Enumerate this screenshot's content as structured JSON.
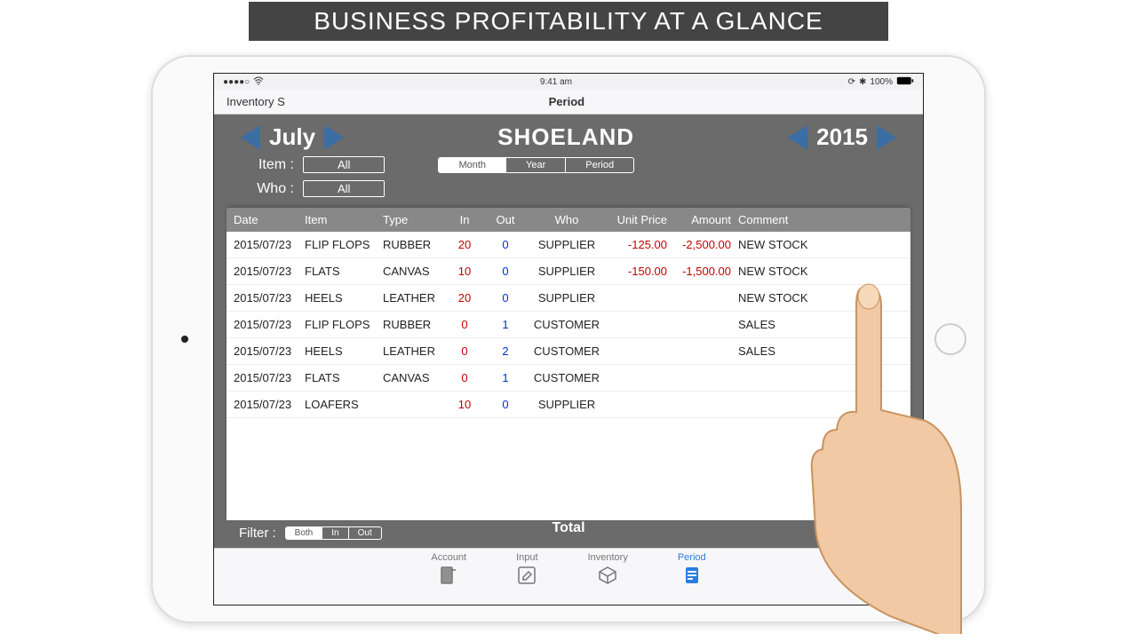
{
  "banner": "BUSINESS PROFITABILITY AT A GLANCE",
  "status": {
    "time": "9:41 am",
    "battery": "100%"
  },
  "nav": {
    "back": "Inventory S",
    "title": "Period"
  },
  "period": {
    "month": "July",
    "company": "SHOELAND",
    "year": "2015"
  },
  "filters": {
    "item_label": "Item :",
    "item_value": "All",
    "who_label": "Who :",
    "who_value": "All"
  },
  "view_tabs": [
    "Month",
    "Year",
    "Period"
  ],
  "view_active": 0,
  "columns": [
    "Date",
    "Item",
    "Type",
    "In",
    "Out",
    "Who",
    "Unit Price",
    "Amount",
    "Comment"
  ],
  "rows": [
    {
      "date": "2015/07/23",
      "item": "FLIP FLOPS",
      "type": "RUBBER",
      "in": "20",
      "out": "0",
      "who": "SUPPLIER",
      "price": "-125.00",
      "amount": "-2,500.00",
      "comment": "NEW STOCK"
    },
    {
      "date": "2015/07/23",
      "item": "FLATS",
      "type": "CANVAS",
      "in": "10",
      "out": "0",
      "who": "SUPPLIER",
      "price": "-150.00",
      "amount": "-1,500.00",
      "comment": "NEW STOCK"
    },
    {
      "date": "2015/07/23",
      "item": "HEELS",
      "type": "LEATHER",
      "in": "20",
      "out": "0",
      "who": "SUPPLIER",
      "price": "",
      "amount": "",
      "comment": "NEW STOCK"
    },
    {
      "date": "2015/07/23",
      "item": "FLIP FLOPS",
      "type": "RUBBER",
      "in": "0",
      "out": "1",
      "who": "CUSTOMER",
      "price": "",
      "amount": "",
      "comment": "SALES"
    },
    {
      "date": "2015/07/23",
      "item": "HEELS",
      "type": "LEATHER",
      "in": "0",
      "out": "2",
      "who": "CUSTOMER",
      "price": "",
      "amount": "",
      "comment": "SALES"
    },
    {
      "date": "2015/07/23",
      "item": "FLATS",
      "type": "CANVAS",
      "in": "0",
      "out": "1",
      "who": "CUSTOMER",
      "price": "",
      "amount": "",
      "comment": ""
    },
    {
      "date": "2015/07/23",
      "item": "LOAFERS",
      "type": "",
      "in": "10",
      "out": "0",
      "who": "SUPPLIER",
      "price": "",
      "amount": "",
      "comment": ""
    }
  ],
  "footer": {
    "filter_label": "Filter :",
    "filter_opts": [
      "Both",
      "In",
      "Out"
    ],
    "filter_active": 0,
    "total_label": "Total"
  },
  "tabs": [
    {
      "id": "account",
      "label": "Account"
    },
    {
      "id": "input",
      "label": "Input"
    },
    {
      "id": "inventory",
      "label": "Inventory"
    },
    {
      "id": "period",
      "label": "Period"
    }
  ],
  "tab_active": 3
}
